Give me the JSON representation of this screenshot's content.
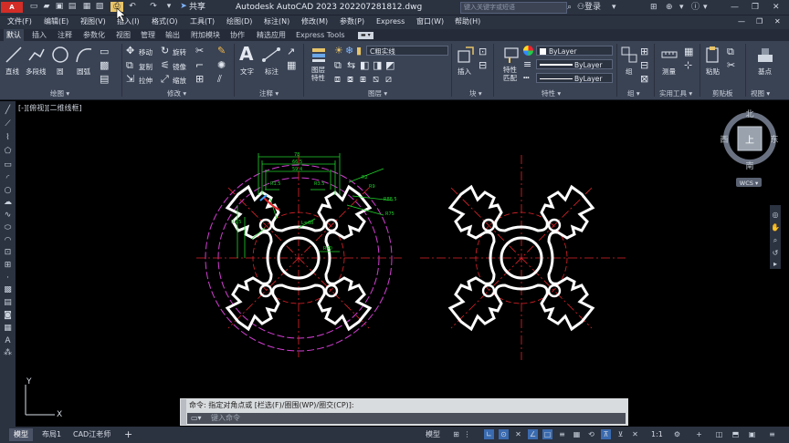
{
  "titlebar": {
    "app_badge": "A CAD",
    "share": "共享",
    "title": "Autodesk AutoCAD 2023    202207281812.dwg",
    "search_placeholder": "键入关键字或短语",
    "login": "登录"
  },
  "menu": [
    "文件(F)",
    "编辑(E)",
    "视图(V)",
    "插入(I)",
    "格式(O)",
    "工具(T)",
    "绘图(D)",
    "标注(N)",
    "修改(M)",
    "参数(P)",
    "Express",
    "窗口(W)",
    "帮助(H)"
  ],
  "tabs": [
    "默认",
    "插入",
    "注释",
    "参数化",
    "视图",
    "管理",
    "输出",
    "附加模块",
    "协作",
    "精选应用",
    "Express Tools"
  ],
  "ribbon": {
    "draw": {
      "line": "直线",
      "polyline": "多段线",
      "circle": "圆",
      "arc": "圆弧",
      "panel": "绘图 ▾"
    },
    "modify": {
      "move": "移动",
      "rotate": "旋转",
      "copy": "复制",
      "mirror": "镜像",
      "stretch": "拉伸",
      "scale": "缩放",
      "panel": "修改 ▾"
    },
    "annotation": {
      "text": "文字",
      "dimension": "标注",
      "panel": "注释 ▾"
    },
    "layers": {
      "layer_props": "图层\n特性",
      "current_layer": "C粗实线",
      "panel": "图层 ▾"
    },
    "block": {
      "insert": "插入",
      "panel": "块 ▾"
    },
    "properties": {
      "match": "特性\n匹配",
      "color": "ByLayer",
      "linetype": "ByLayer",
      "lineweight": "ByLayer",
      "panel": "特性 ▾"
    },
    "groups": {
      "group": "组",
      "panel": "组 ▾"
    },
    "utilities": {
      "measure": "测量",
      "panel": "实用工具 ▾"
    },
    "clipboard": {
      "paste": "粘贴",
      "panel": "剪贴板"
    },
    "view": {
      "basepoint": "基点",
      "panel": "视图 ▾"
    }
  },
  "viewport_label": "[-][俯视][二维线框]",
  "viewcube": {
    "north": "北",
    "south": "南",
    "east": "东",
    "west": "西",
    "top": "上",
    "wcs": "WCS ▾"
  },
  "ucs": {
    "x": "X",
    "y": "Y"
  },
  "dims": [
    "78",
    "66.5",
    "59.4",
    "R1.5",
    "R3.5",
    "R2",
    "R9",
    "R88.5",
    "R75",
    "L=68",
    "R40",
    "R1.5"
  ],
  "command": {
    "history": "命令: 指定对角点或 [栏选(F)/圈围(WP)/圈交(CP)]:",
    "input_placeholder": "键入命令"
  },
  "statusbar": {
    "tabs": [
      "模型",
      "布局1",
      "CAD江老师"
    ],
    "add": "+",
    "model": "模型",
    "scale": "1:1"
  },
  "colors": {
    "accent": "#3a4354",
    "dim_green": "#1fd22b",
    "center_red": "#e0232a",
    "circle_magenta": "#d23ed2"
  }
}
